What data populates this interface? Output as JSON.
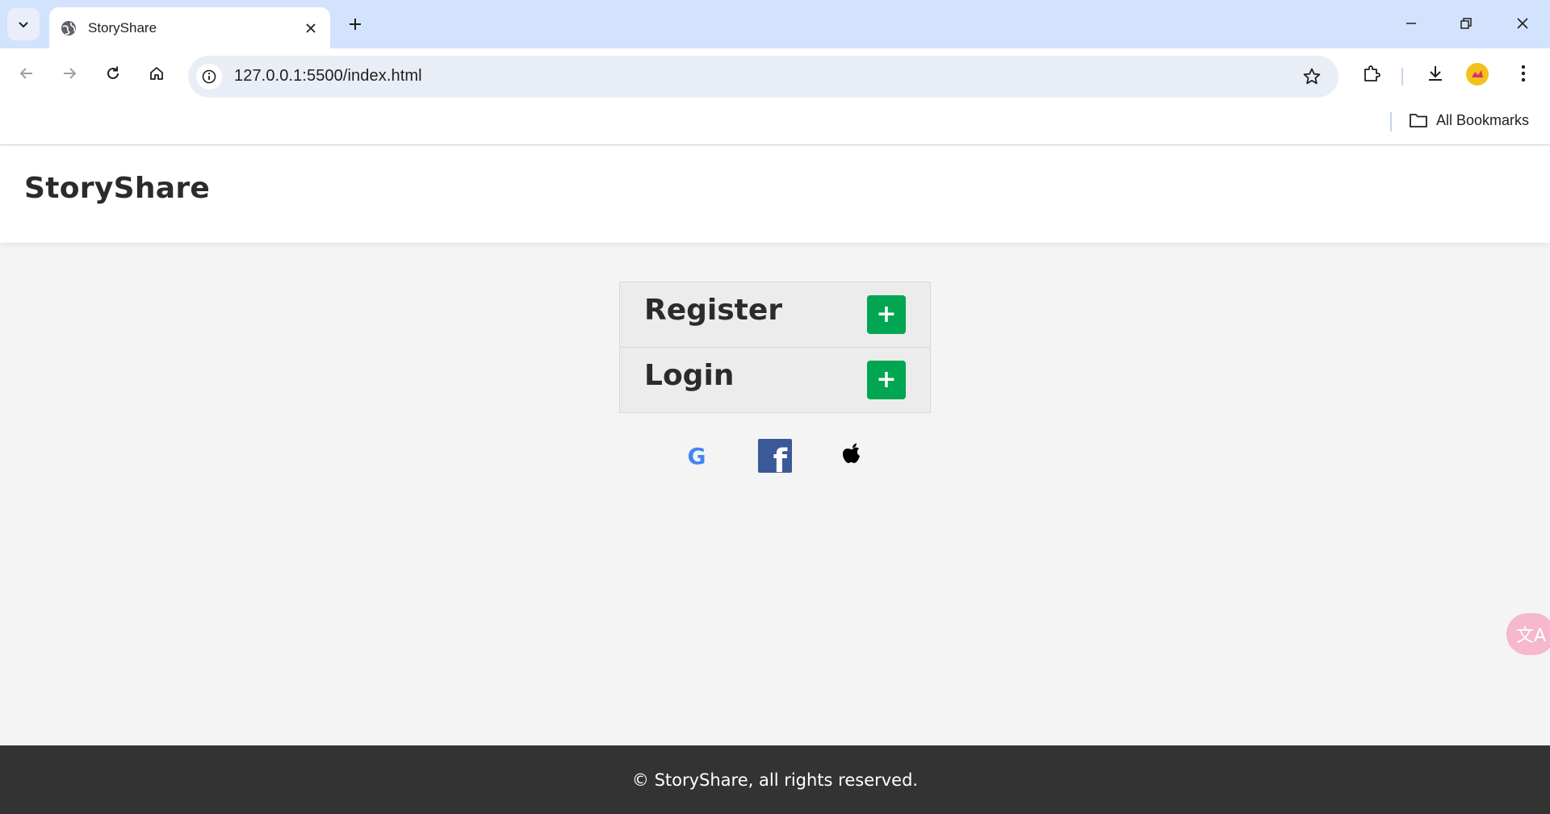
{
  "browser": {
    "tab": {
      "title": "StoryShare"
    },
    "address_bar": {
      "url": "127.0.0.1:5500/index.html"
    },
    "bookmarks_bar": {
      "all_bookmarks_label": "All Bookmarks"
    }
  },
  "site": {
    "header": {
      "logo": "StoryShare"
    },
    "auth_panel": {
      "items": [
        {
          "label": "Register",
          "button_label": "+"
        },
        {
          "label": "Login",
          "button_label": "+"
        }
      ]
    },
    "social_login": {
      "google_label": "G",
      "facebook_label": "f"
    },
    "footer": {
      "text": "© StoryShare, all rights reserved."
    },
    "translate_widget": {
      "label": "文A"
    }
  },
  "colors": {
    "tabstrip": "#d3e3fd",
    "accent_green": "#00a651",
    "footer_bg": "#333333",
    "facebook_blue": "#3b5998"
  }
}
